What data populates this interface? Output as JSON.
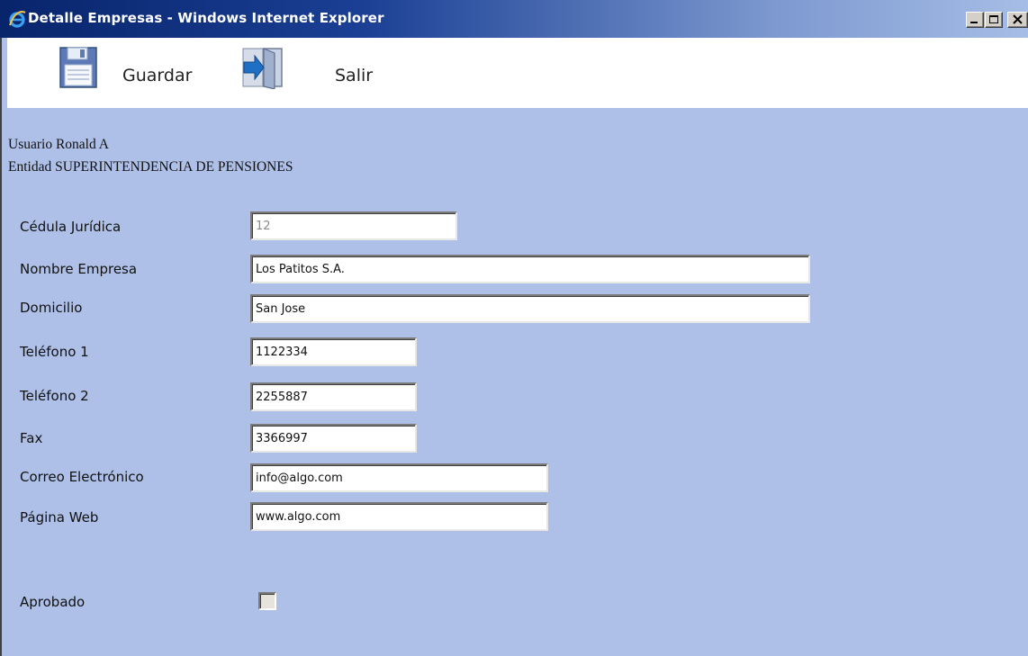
{
  "window": {
    "title": "Detalle Empresas - Windows Internet Explorer",
    "icon": "internet-explorer-icon",
    "controls": [
      "minimize-icon",
      "maximize-icon",
      "close-icon"
    ]
  },
  "toolbar": {
    "save_label": "Guardar",
    "save_icon": "floppy-disk-icon",
    "exit_label": "Salir",
    "exit_icon": "exit-door-icon"
  },
  "user_info": {
    "user_line": "Usuario Ronald A",
    "entity_line": "Entidad SUPERINTENDENCIA DE PENSIONES"
  },
  "form": {
    "cedula": {
      "label": "Cédula Jurídica",
      "value": "12",
      "disabled": true
    },
    "nombre": {
      "label": "Nombre Empresa",
      "value": "Los Patitos S.A."
    },
    "domicilio": {
      "label": "Domicilio",
      "value": "San Jose"
    },
    "telefono1": {
      "label": "Teléfono 1",
      "value": "1122334"
    },
    "telefono2": {
      "label": "Teléfono 2",
      "value": "2255887"
    },
    "fax": {
      "label": "Fax",
      "value": "3366997"
    },
    "correo": {
      "label": "Correo Electrónico",
      "value": "info@algo.com"
    },
    "pagina": {
      "label": "Página Web",
      "value": "www.algo.com"
    },
    "aprobado": {
      "label": "Aprobado",
      "checked": false,
      "disabled": true
    }
  },
  "colors": {
    "background": "#aec0e8",
    "titlebar_start": "#08246b",
    "titlebar_end": "#a6bde6",
    "toolbar": "#ffffff"
  }
}
